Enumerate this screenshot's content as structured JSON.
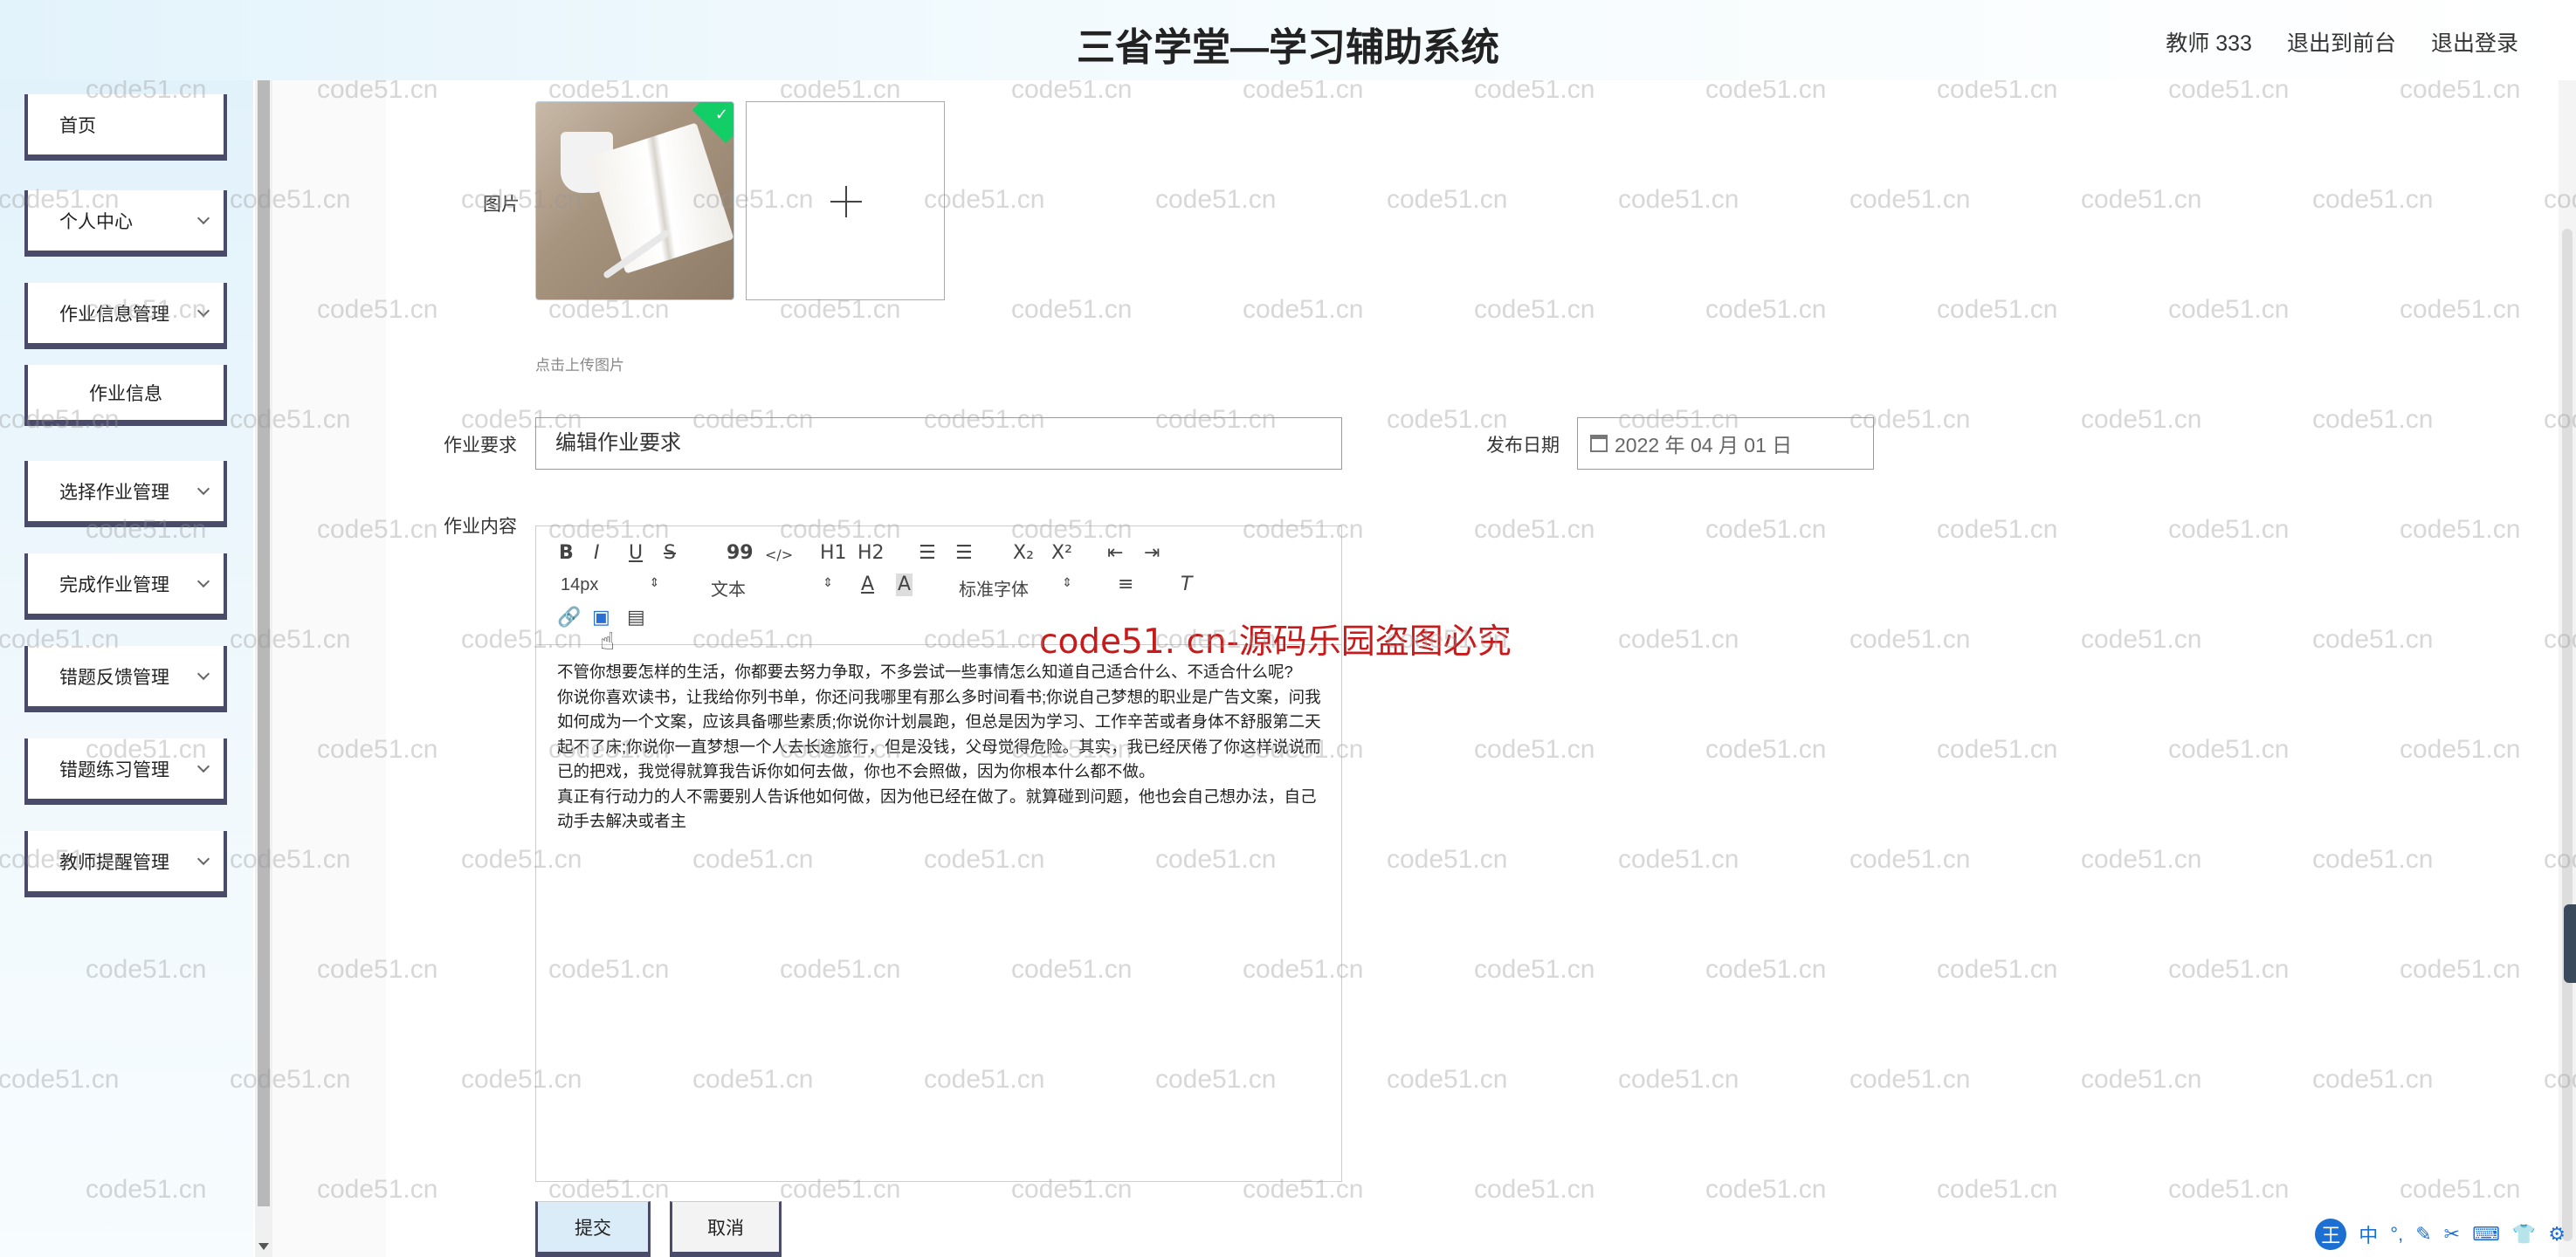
{
  "header": {
    "title": "三省学堂—学习辅助系统",
    "user": "教师 333",
    "to_front": "退出到前台",
    "logout": "退出登录"
  },
  "sidebar": {
    "items": [
      {
        "label": "首页"
      },
      {
        "label": "个人中心"
      },
      {
        "label": "作业信息管理"
      },
      {
        "label": "作业信息"
      },
      {
        "label": "选择作业管理"
      },
      {
        "label": "完成作业管理"
      },
      {
        "label": "错题反馈管理"
      },
      {
        "label": "错题练习管理"
      },
      {
        "label": "教师提醒管理"
      }
    ]
  },
  "form": {
    "image_label": "图片",
    "upload_hint": "点击上传图片",
    "requirement_label": "作业要求",
    "requirement_value": "编辑作业要求",
    "date_label": "发布日期",
    "date_value": "2022 年 04 月 01 日",
    "content_label": "作业内容"
  },
  "editor": {
    "toolbar": {
      "bold": "B",
      "italic": "I",
      "underline": "U",
      "strike": "S",
      "quote": "99",
      "code": "</>",
      "h1": "H1",
      "h2": "H2",
      "sub": "X₂",
      "sup": "X²",
      "size": "14px",
      "header": "文本",
      "font": "标准字体"
    },
    "paragraphs": [
      "不管你想要怎样的生活，你都要去努力争取，不多尝试一些事情怎么知道自己适合什么、不适合什么呢?",
      "你说你喜欢读书，让我给你列书单，你还问我哪里有那么多时间看书;你说自己梦想的职业是广告文案，问我如何成为一个文案，应该具备哪些素质;你说你计划晨跑，但总是因为学习、工作辛苦或者身体不舒服第二天起不了床;你说你一直梦想一个人去长途旅行，但是没钱，父母觉得危险。其实，我已经厌倦了你这样说说而已的把戏，我觉得就算我告诉你如何去做，你也不会照做，因为你根本什么都不做。",
      "真正有行动力的人不需要别人告诉他如何做，因为他已经在做了。就算碰到问题，他也会自己想办法，自己动手去解决或者主"
    ]
  },
  "buttons": {
    "submit": "提交",
    "cancel": "取消"
  },
  "watermark": {
    "text": "code51.cn",
    "notice": "code51. cn-源码乐园盗图必究"
  },
  "ime": {
    "logo": "王",
    "mode": "中"
  }
}
